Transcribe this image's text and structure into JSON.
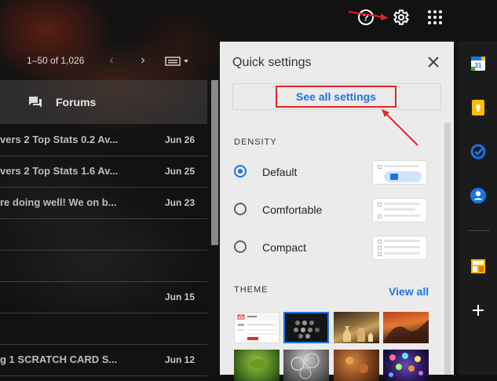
{
  "header": {
    "help_icon": "help-icon",
    "settings_icon": "gear-icon",
    "apps_icon": "apps-grid-icon"
  },
  "toolbar": {
    "range": "1–50 of 1,026"
  },
  "inbox": {
    "tab_label": "Forums",
    "rows": [
      {
        "subject": "vers 2 Top Stats 0.2 Av...",
        "date": "Jun 26"
      },
      {
        "subject": "vers 2 Top Stats 1.6 Av...",
        "date": "Jun 25"
      },
      {
        "subject": "re doing well! We on b...",
        "date": "Jun 23"
      },
      {
        "subject": "",
        "date": ""
      },
      {
        "subject": "",
        "date": ""
      },
      {
        "subject": "",
        "date": "Jun 15"
      },
      {
        "subject": "",
        "date": ""
      },
      {
        "subject": "g 1 SCRATCH CARD S...",
        "date": "Jun 12"
      }
    ]
  },
  "quick_settings": {
    "title": "Quick settings",
    "see_all": "See all settings",
    "density_heading": "DENSITY",
    "density_options": [
      {
        "label": "Default",
        "selected": true
      },
      {
        "label": "Comfortable",
        "selected": false
      },
      {
        "label": "Compact",
        "selected": false
      }
    ],
    "theme_heading": "THEME",
    "view_all": "View all"
  },
  "colors": {
    "accent": "#1a73e8",
    "annotation": "#e0252a",
    "panel_bg": "#ebebeb"
  }
}
